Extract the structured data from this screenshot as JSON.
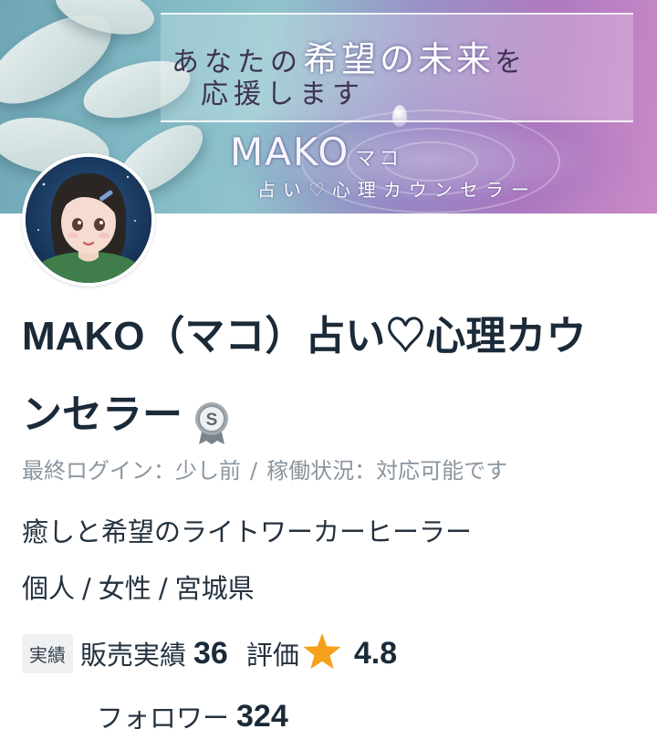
{
  "banner": {
    "tagline_prefix": "あなたの",
    "tagline_highlight": "希望の未来",
    "tagline_suffix": "を",
    "tagline_line2": "応援します",
    "brand_name": "MAKO",
    "brand_kana": "マコ",
    "brand_subtitle": "占い♡心理カウンセラー"
  },
  "profile": {
    "display_name": "MAKO（マコ）占い♡心理カウンセラー",
    "badge_letter": "S",
    "last_login": "最終ログイン：少し前",
    "separator": "/",
    "availability": "稼働状況：対応可能です",
    "catchphrase": "癒しと希望のライトワーカーヒーラー",
    "type": "個人",
    "gender": "女性",
    "prefecture": "宮城県"
  },
  "stats": {
    "chip": "実績",
    "sales_label": "販売実績",
    "sales_count": "36",
    "rating_label": "評価",
    "rating_value": "4.8",
    "followers_label": "フォロワー",
    "followers_count": "324"
  },
  "colors": {
    "star": "#f5a11c",
    "badge": "#8e979f",
    "text": "#1b2a38",
    "muted": "#8b959e"
  }
}
